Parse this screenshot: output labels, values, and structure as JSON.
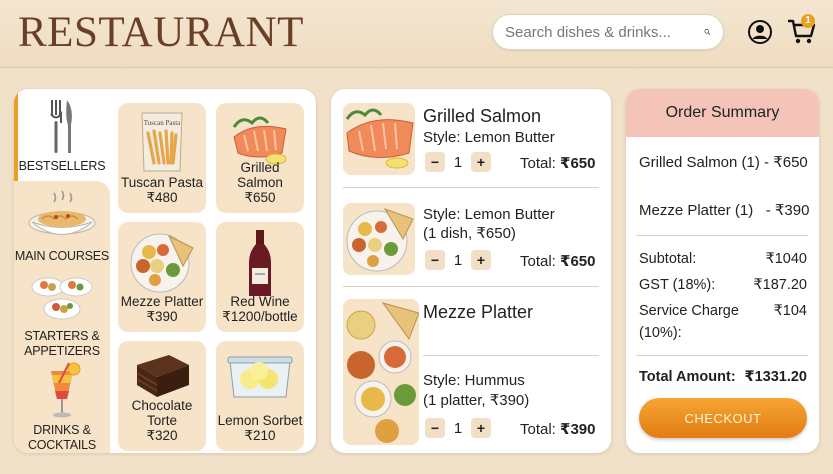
{
  "header": {
    "logo": "RESTAURANT",
    "search_placeholder": "Search dishes & drinks...",
    "cart_count": "1"
  },
  "categories": [
    {
      "label": "BESTSELLERS",
      "icon": "fork-knife-icon",
      "active": true
    },
    {
      "label": "MAIN COURSES",
      "icon": "pasta-bowl-icon",
      "active": false
    },
    {
      "label": "STARTERS & APPETIZERS",
      "icon": "appetizer-plates-icon",
      "active": false
    },
    {
      "label": "DRINKS & COCKTAILS",
      "icon": "cocktail-icon",
      "active": false
    }
  ],
  "menu_items": [
    {
      "name": "Tuscan Pasta",
      "price": "₹480",
      "icon": "pasta-bag-icon",
      "bag_text": "Tuscan Pasta"
    },
    {
      "name": "Grilled Salmon",
      "price": "₹650",
      "icon": "salmon-icon"
    },
    {
      "name": "Mezze Platter",
      "price": "₹390",
      "icon": "mezze-platter-icon"
    },
    {
      "name": "Red Wine",
      "price": "₹1200/bottle",
      "icon": "wine-bottle-icon"
    },
    {
      "name": "Chocolate Torte",
      "price": "₹320",
      "icon": "chocolate-torte-icon"
    },
    {
      "name": "Lemon Sorbet",
      "price": "₹210",
      "icon": "sorbet-container-icon"
    }
  ],
  "cart": [
    {
      "title": "Grilled Salmon",
      "style": "Style: Lemon Butter",
      "style2": "",
      "qty": "1",
      "total_label": "Total:",
      "total": "₹650",
      "minus": "−",
      "plus": "+"
    },
    {
      "title": "",
      "style": "Style: Lemon Butter",
      "style2": "(1 dish, ₹650)",
      "qty": "1",
      "total_label": "Total:",
      "total": "₹650",
      "minus": "−",
      "plus": "+"
    },
    {
      "title": "Mezze Platter",
      "style": "Style: Hummus",
      "style2": "(1 platter, ₹390)",
      "qty": "1",
      "total_label": "Total:",
      "total": "₹390",
      "minus": "−",
      "plus": "+"
    }
  ],
  "summary": {
    "title": "Order Summary",
    "lines": [
      "Grilled Salmon (1) - ₹650",
      "Mezze Platter (1)   - ₹390"
    ],
    "subtotal_label": "Subtotal:",
    "subtotal": "₹1040",
    "gst_label": "GST (18%):",
    "gst": "₹187.20",
    "service_label": "Service Charge",
    "service_label2": "(10%):",
    "service": "₹104",
    "total_label": "Total Amount:",
    "total": "₹1331.20",
    "checkout": "CHECKOUT"
  },
  "colors": {
    "accent": "#e8a020",
    "card_bg": "#f6e3c8",
    "summary_header": "#f4c4b8",
    "logo": "#6b3f26"
  }
}
